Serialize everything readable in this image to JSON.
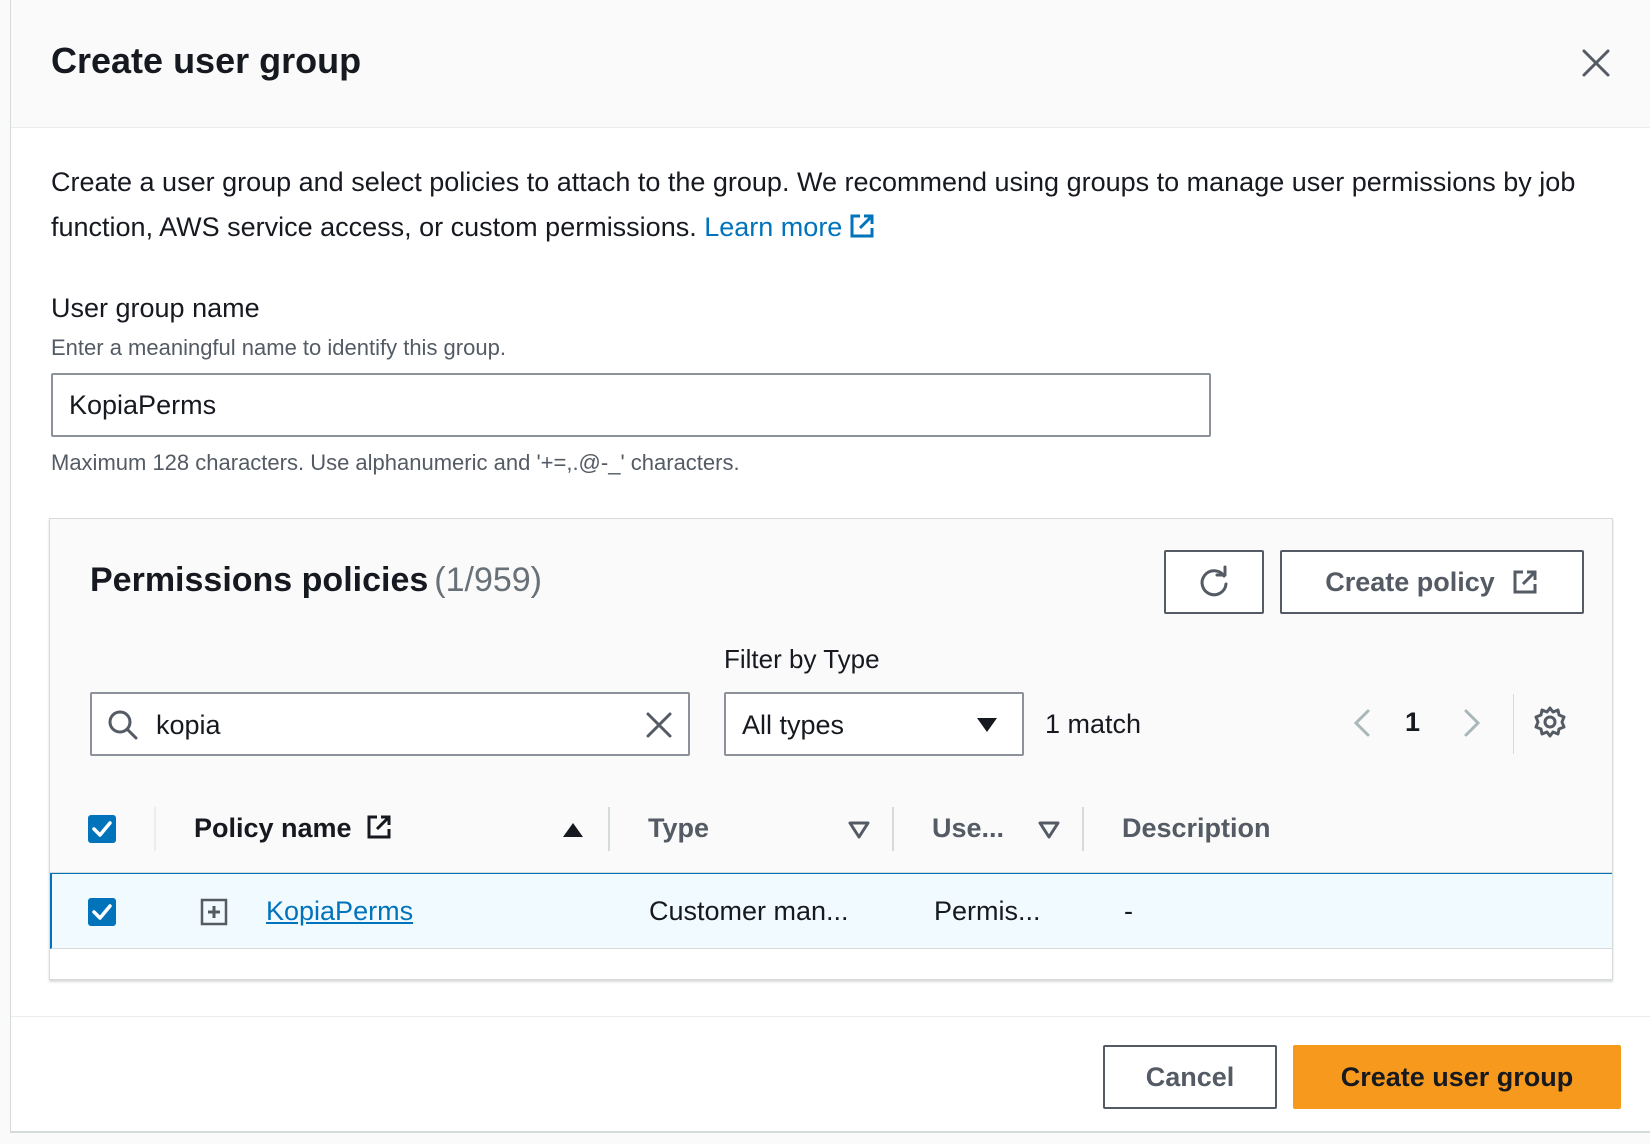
{
  "modal": {
    "title": "Create user group"
  },
  "intro": {
    "text": "Create a user group and select policies to attach to the group. We recommend using groups to manage user permissions by job function, AWS service access, or custom permissions.",
    "learn_more": "Learn more"
  },
  "group_name": {
    "label": "User group name",
    "description": "Enter a meaningful name to identify this group.",
    "value": "KopiaPerms",
    "hint": "Maximum 128 characters. Use alphanumeric and '+=,.@-_' characters."
  },
  "policies": {
    "title": "Permissions policies",
    "count": "(1/959)",
    "create_policy_label": "Create policy",
    "filter_label": "Filter by Type",
    "search_value": "kopia",
    "filter_value": "All types",
    "match_count": "1 match",
    "current_page": "1",
    "columns": {
      "policy_name": "Policy name",
      "type": "Type",
      "used_as": "Use...",
      "description": "Description"
    },
    "rows": [
      {
        "policy_name": "KopiaPerms",
        "type": "Customer man...",
        "used_as": "Permis...",
        "description": "-"
      }
    ]
  },
  "footer": {
    "cancel_label": "Cancel",
    "create_label": "Create user group"
  },
  "colors": {
    "link": "#0073bb",
    "primary": "#f7991c",
    "selected_row": "#f1faff"
  }
}
